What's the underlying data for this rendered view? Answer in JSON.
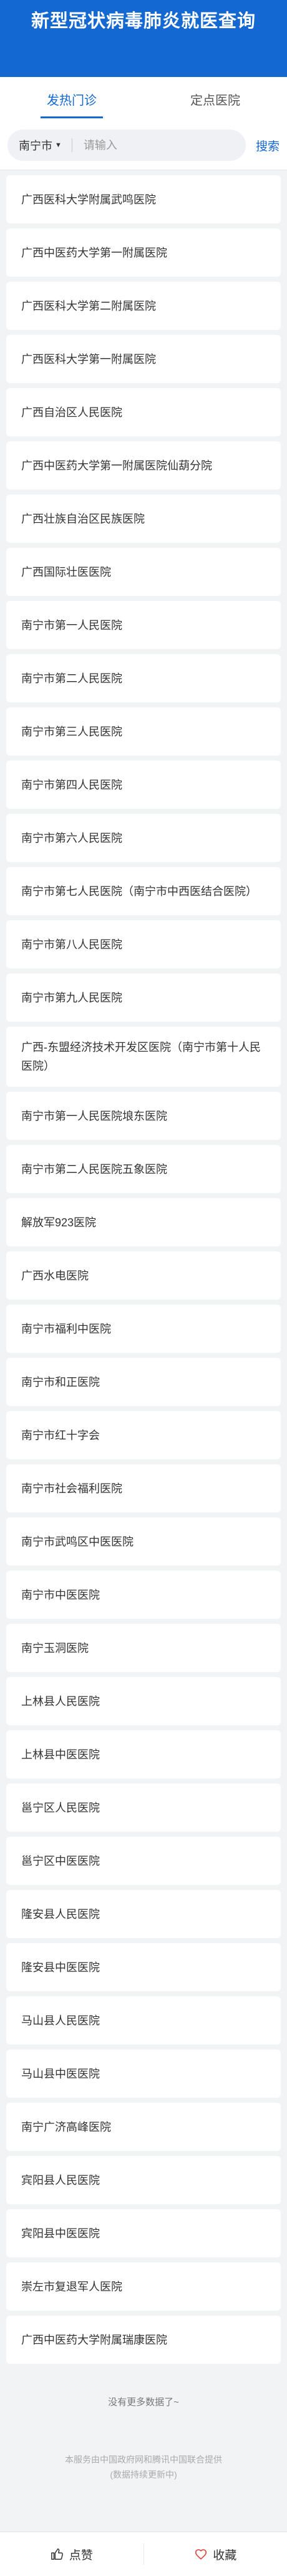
{
  "header": {
    "title": "新型冠状病毒肺炎就医查询"
  },
  "tabs": [
    {
      "label": "发热门诊"
    },
    {
      "label": "定点医院"
    }
  ],
  "search": {
    "city": "南宁市",
    "placeholder": "请输入",
    "button": "搜索"
  },
  "hospitals": [
    "广西医科大学附属武鸣医院",
    "广西中医药大学第一附属医院",
    "广西医科大学第二附属医院",
    "广西医科大学第一附属医院",
    "广西自治区人民医院",
    "广西中医药大学第一附属医院仙葫分院",
    "广西壮族自治区民族医院",
    "广西国际壮医医院",
    "南宁市第一人民医院",
    "南宁市第二人民医院",
    "南宁市第三人民医院",
    "南宁市第四人民医院",
    "南宁市第六人民医院",
    "南宁市第七人民医院（南宁市中西医结合医院）",
    "南宁市第八人民医院",
    "南宁市第九人民医院",
    "广西-东盟经济技术开发区医院（南宁市第十人民医院）",
    "南宁市第一人民医院埌东医院",
    "南宁市第二人民医院五象医院",
    "解放军923医院",
    "广西水电医院",
    "南宁市福利中医院",
    "南宁市和正医院",
    "南宁市红十字会",
    "南宁市社会福利医院",
    "南宁市武鸣区中医医院",
    "南宁市中医医院",
    "南宁玉洞医院",
    "上林县人民医院",
    "上林县中医医院",
    "邕宁区人民医院",
    "邕宁区中医医院",
    "隆安县人民医院",
    "隆安县中医医院",
    "马山县人民医院",
    "马山县中医医院",
    "南宁广济高峰医院",
    "宾阳县人民医院",
    "宾阳县中医医院",
    "崇左市复退军人医院",
    "广西中医药大学附属瑞康医院"
  ],
  "footer": {
    "no_more": "没有更多数据了~",
    "source_line1": "本服务由中国政府网和腾讯中国联合提供",
    "source_line2": "(数据持续更新中)"
  },
  "bottom_bar": {
    "like": "点赞",
    "favorite": "收藏"
  },
  "colors": {
    "brand": "#1468d2",
    "heart": "#e64340"
  }
}
